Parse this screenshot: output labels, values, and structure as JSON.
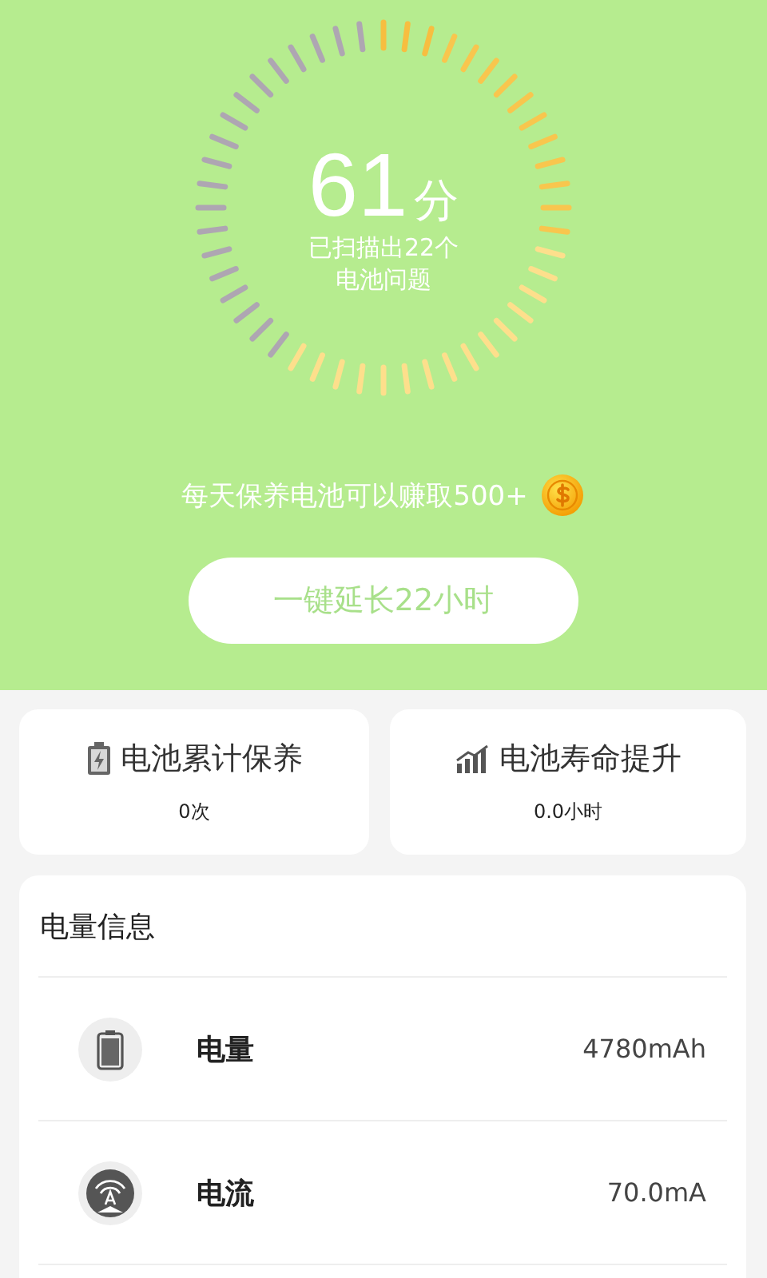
{
  "gauge": {
    "score": "61",
    "unit": "分",
    "caption_lines": [
      "已扫描出22个",
      "电池问题"
    ]
  },
  "reward": {
    "text": "每天保养电池可以赚取500+"
  },
  "action_button": {
    "label": "一键延长22小时"
  },
  "stats": [
    {
      "kind": "battery",
      "title": "电池累计保养",
      "value": "0次"
    },
    {
      "kind": "signal",
      "title": "电池寿命提升",
      "value": "0.0小时"
    }
  ],
  "info": {
    "title": "电量信息",
    "rows": [
      {
        "kind": "capacity",
        "label": "电量",
        "value": "4780mAh"
      },
      {
        "kind": "current",
        "label": "电流",
        "value": "70.0mA"
      }
    ]
  }
}
